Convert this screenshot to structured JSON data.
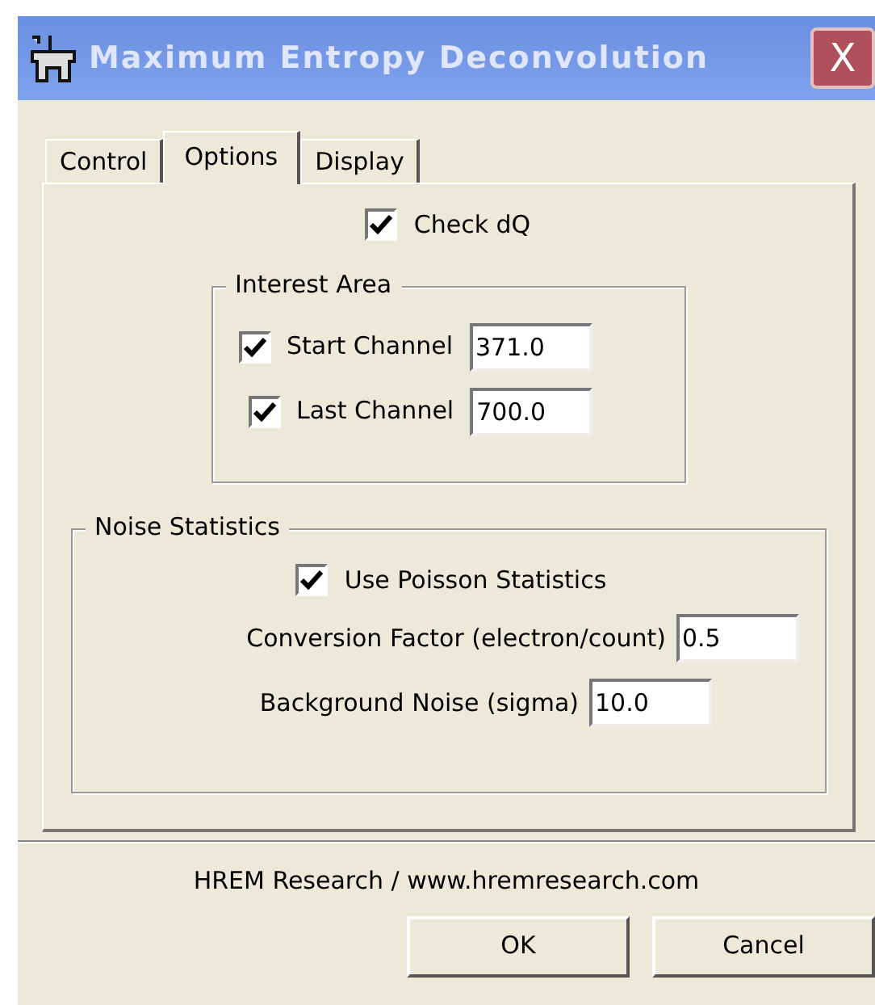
{
  "window": {
    "title": "Maximum Entropy Deconvolution",
    "close_label": "X"
  },
  "tabs": [
    {
      "label": "Control",
      "selected": false
    },
    {
      "label": "Options",
      "selected": true
    },
    {
      "label": "Display",
      "selected": false
    }
  ],
  "check_dq": {
    "label": "Check dQ",
    "checked": true
  },
  "interest_area": {
    "title": "Interest Area",
    "rows": [
      {
        "label": "Start Channel",
        "checked": true,
        "value": "371.0"
      },
      {
        "label": "Last Channel",
        "checked": true,
        "value": "700.0"
      }
    ]
  },
  "noise_statistics": {
    "title": "Noise Statistics",
    "use_poisson": {
      "label": "Use Poisson Statistics",
      "checked": true
    },
    "fields": [
      {
        "label": "Conversion Factor (electron/count)",
        "value": "0.5"
      },
      {
        "label": "Background Noise (sigma)",
        "value": "10.0"
      }
    ]
  },
  "footer": "HREM Research / www.hremresearch.com",
  "buttons": [
    "OK",
    "Cancel"
  ]
}
